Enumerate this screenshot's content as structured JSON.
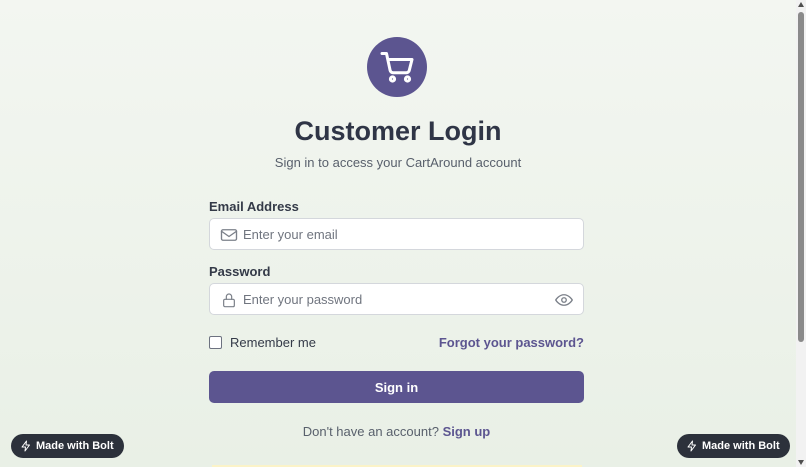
{
  "login": {
    "title": "Customer Login",
    "subtitle": "Sign in to access your CartAround account",
    "email_label": "Email Address",
    "email_placeholder": "Enter your email",
    "email_value": "",
    "password_label": "Password",
    "password_placeholder": "Enter your password",
    "password_value": "",
    "remember_label": "Remember me",
    "remember_checked": false,
    "forgot_label": "Forgot your password?",
    "signin_label": "Sign in",
    "signup_prompt": "Don't have an account?",
    "signup_label": "Sign up"
  },
  "badges": {
    "left_label": "Made with Bolt",
    "right_label": "Made with Bolt"
  },
  "icons": {
    "logo": "shopping-cart-icon",
    "email": "mail-icon",
    "password": "lock-icon",
    "toggle": "eye-icon",
    "badge": "bolt-icon"
  },
  "colors": {
    "brand": "#5c5590",
    "text": "#2f3546",
    "badge_bg": "#2c313b"
  }
}
